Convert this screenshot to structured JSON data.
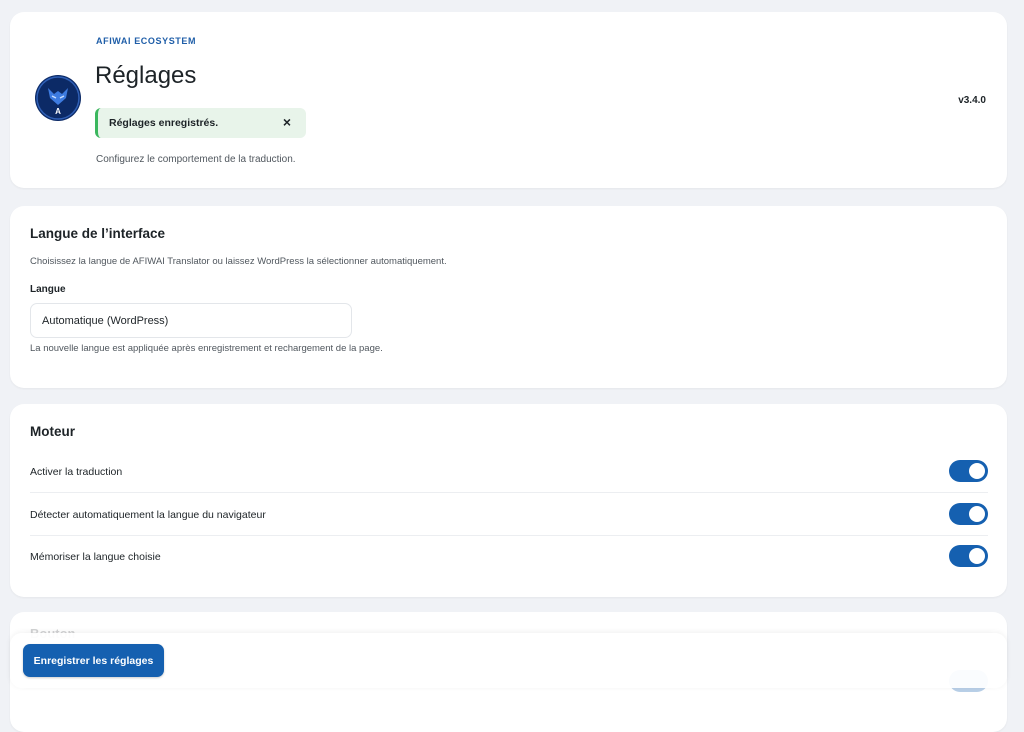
{
  "header": {
    "brand": "AFIWAI ECOSYSTEM",
    "title": "Réglages",
    "notice": "Réglages enregistrés.",
    "close_symbol": "×",
    "subtitle": "Configurez le comportement de la traduction.",
    "version": "v3.4.0",
    "logo_icon": "afiwai-logo"
  },
  "language_section": {
    "title": "Langue de l’interface",
    "description": "Choisissez la langue de AFIWAI Translator ou laissez WordPress la sélectionner automatiquement.",
    "field_label": "Langue",
    "selected_value": "Automatique (WordPress)",
    "help": "La nouvelle langue est appliquée après enregistrement et rechargement de la page."
  },
  "engine_section": {
    "title": "Moteur",
    "toggles": [
      {
        "label": "Activer la traduction",
        "enabled": true
      },
      {
        "label": "Détecter automatiquement la langue du navigateur",
        "enabled": true
      },
      {
        "label": "Mémoriser la langue choisie",
        "enabled": true
      }
    ]
  },
  "next_section": {
    "title": "Bouton"
  },
  "footer": {
    "save_label": "Enregistrer les réglages"
  },
  "colors": {
    "accent": "#1560b0",
    "brand": "#1f5ea8",
    "success": "#3bb75e",
    "background": "#f0f2f6"
  }
}
